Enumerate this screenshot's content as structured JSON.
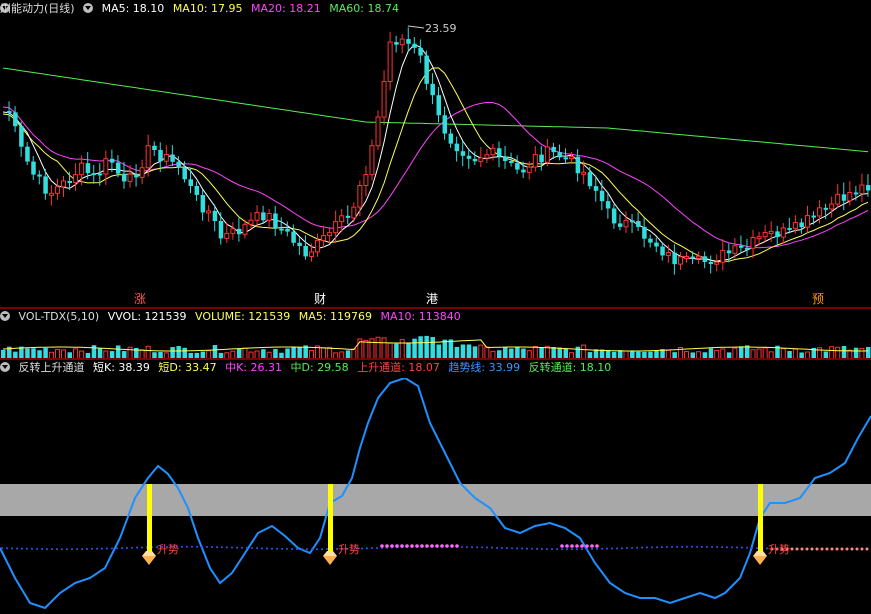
{
  "main": {
    "title": "川能动力(日线)",
    "ma": [
      {
        "label": "MA5: 18.10",
        "color": "#ffffff"
      },
      {
        "label": "MA10: 17.95",
        "color": "#ffff55"
      },
      {
        "label": "MA20: 18.21",
        "color": "#ff44ff"
      },
      {
        "label": "MA60: 18.74",
        "color": "#55ee55"
      }
    ],
    "peak_label": "23.59",
    "events": [
      {
        "text": "涨",
        "color": "#ff5555"
      },
      {
        "text": "财",
        "color": "#ffffff"
      },
      {
        "text": "港",
        "color": "#ffffff"
      },
      {
        "text": "预",
        "color": "#ff9900"
      }
    ]
  },
  "vol": {
    "title": "VOL-TDX(5,10)",
    "items": [
      {
        "label": "VVOL: 121539",
        "color": "#ffffff"
      },
      {
        "label": "VOLUME: 121539",
        "color": "#ffff55"
      },
      {
        "label": "MA5: 119769",
        "color": "#ffff55"
      },
      {
        "label": "MA10: 113840",
        "color": "#ff44ff"
      }
    ]
  },
  "ind": {
    "title": "反转上升通道",
    "items": [
      {
        "label": "短K: 38.39",
        "color": "#ffffff"
      },
      {
        "label": "短D: 33.47",
        "color": "#ffff55"
      },
      {
        "label": "中K: 26.31",
        "color": "#ff44ff"
      },
      {
        "label": "中D: 29.58",
        "color": "#55ee55"
      },
      {
        "label": "上升通道: 18.07",
        "color": "#ff4444"
      },
      {
        "label": "趋势线: 33.99",
        "color": "#3399ff"
      },
      {
        "label": "反转通道: 18.10",
        "color": "#55ee55"
      }
    ],
    "signals": [
      "升势",
      "升势",
      "升势"
    ]
  },
  "colors": {
    "up": "#ff3333",
    "down": "#33dddd",
    "bg": "#000000",
    "ma5": "#ffffff",
    "ma10": "#ffff55",
    "ma20": "#ff44ff",
    "ma60": "#55ee55",
    "trend": "#1e90ff",
    "band": "#a8a8a8",
    "signal_bar": "#ffff00"
  }
}
